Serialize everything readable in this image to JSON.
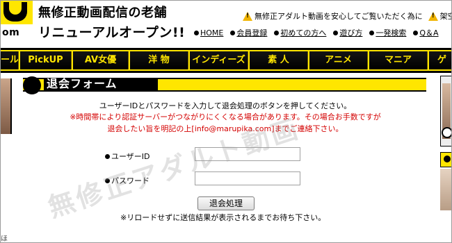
{
  "header": {
    "logo_suffix": "om",
    "slogan_line1": "無修正動画配信の老舗",
    "slogan_line2": "リニューアルオープン!!",
    "notice_text": "無修正アダルト動画を安心してご覧いただく為に",
    "notice_text2": "架空",
    "nav": [
      {
        "label": "HOME"
      },
      {
        "label": "会員登録"
      },
      {
        "label": "初めての方へ"
      },
      {
        "label": "遊び方"
      },
      {
        "label": "一発検索"
      },
      {
        "label": "Q＆A"
      }
    ]
  },
  "category_bar": {
    "items": [
      {
        "label": "ール"
      },
      {
        "label": "PickUP"
      },
      {
        "label": "AV女優"
      },
      {
        "label": "洋 物"
      },
      {
        "label": "インディーズ"
      },
      {
        "label": "素 人"
      },
      {
        "label": "アニメ"
      },
      {
        "label": "マニア"
      },
      {
        "label": "ゲ"
      }
    ]
  },
  "left_panel": {
    "text": "ほ"
  },
  "form": {
    "section_title": "退会フォーム",
    "instruction": "ユーザーIDとパスワードを入力して退会処理のボタンを押してください。",
    "warning_line1": "※時間帯により認証サーバーがつながりにくくなる場合があります。その場合お手数ですが",
    "warning_line2": "退会したい旨を明記の上[info@marupika.com]までご連絡下さい。",
    "user_id_label": "ユーザーID",
    "user_id_value": "",
    "password_label": "パスワード",
    "password_value": "",
    "submit_label": "退会処理",
    "note": "※リロードせずに送信結果が表示されるまでお待ち下さい。"
  },
  "watermark": "無修正アダルト動画",
  "colors": {
    "accent_yellow": "#ffe600",
    "bar_black": "#000000",
    "warning_red": "#d40000"
  }
}
